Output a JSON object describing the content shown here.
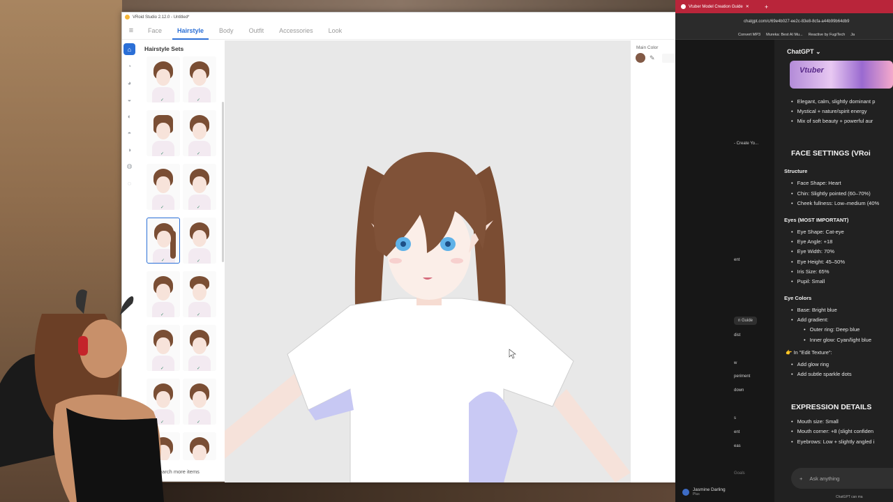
{
  "vroid": {
    "title": "VRoid Studio 2.12.0 - Untitled*",
    "tabs": [
      "Face",
      "Hairstyle",
      "Body",
      "Outfit",
      "Accessories",
      "Look"
    ],
    "active_tab": "Hairstyle",
    "panel_title": "Hairstyle Sets",
    "search_more": "Search more items",
    "main_color_label": "Main Color",
    "main_color_hex": "#825A46",
    "accent_color": "#2b6fd6"
  },
  "browser": {
    "tab_title": "Vtuber Model Creation Guide",
    "url": "chatgpt.com/c/69e4b027-ee2c-83e8-8cfa-a44b99b64db9",
    "bookmarks": [
      "Convert MP3",
      "Mureka: Best AI Mu...",
      "Reactive by FugiTech",
      "Ja"
    ],
    "app_title": "ChatGPT",
    "sidebar": {
      "item_create": "- Create Yo...",
      "item_ent": "ent",
      "item_guide": "n Guide",
      "item_dist": "dist",
      "item_w": "w",
      "item_periment": "periment",
      "item_down": "down",
      "item_s": "s",
      "item_ent2": "ent",
      "item_eas": "eas",
      "item_goals": "Goals",
      "user_name": "Jasmine Darling",
      "user_plan": "Plus"
    },
    "banner_text": "Vtuber",
    "content": {
      "b1": "Elegant, calm, slightly dominant p",
      "b2": "Mystical + nature/spirit energy",
      "b3": "Mix of soft beauty + powerful aur",
      "h_face": "FACE SETTINGS (VRoi",
      "structure": "Structure",
      "s1": "Face Shape: Heart",
      "s2": "Chin: Slightly pointed (60–70%)",
      "s3": "Cheek fullness: Low–medium (40%",
      "eyes": "Eyes (MOST IMPORTANT)",
      "e1": "Eye Shape: Cat-eye",
      "e2": "Eye Angle: +18",
      "e3": "Eye Width: 70%",
      "e4": "Eye Height: 45–50%",
      "e5": "Iris Size: 65%",
      "e6": "Pupil: Small",
      "eye_colors": "Eye Colors",
      "c1": "Base: Bright blue",
      "c2": "Add gradient:",
      "c3": "Outer ring: Deep blue",
      "c4": "Inner glow: Cyan/light blue",
      "edit_texture": "In \"Edit Texture\":",
      "t1": "Add glow ring",
      "t2": "Add subtle sparkle dots",
      "h_expr": "EXPRESSION DETAILS",
      "x1": "Mouth size: Small",
      "x2": "Mouth corner: +8 (slight confiden",
      "x3": "Eyebrows: Low + slightly angled i"
    },
    "ask_placeholder": "Ask anything",
    "footer": "ChatGPT can ma"
  }
}
